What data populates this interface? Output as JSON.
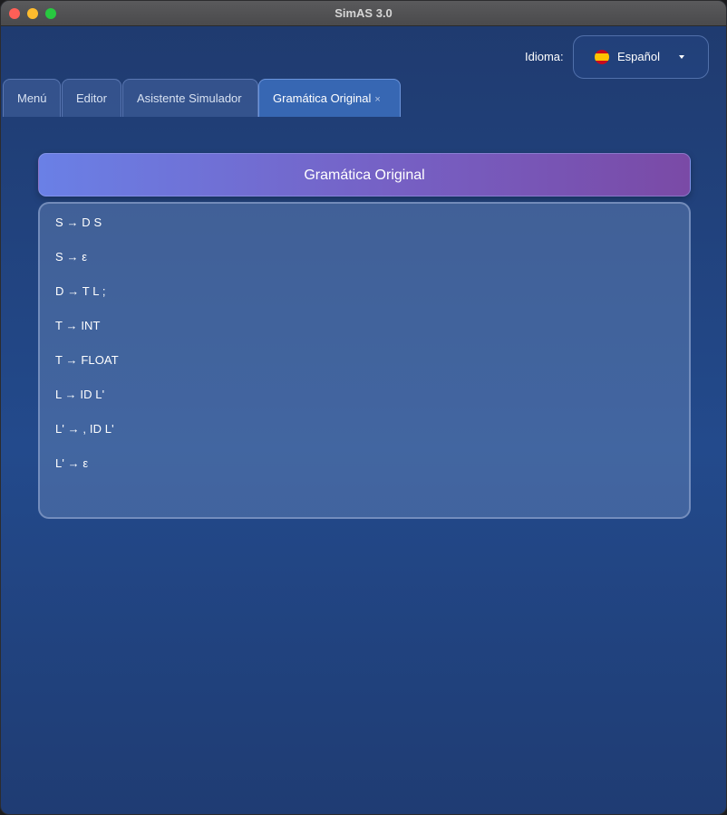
{
  "window": {
    "title": "SimAS 3.0"
  },
  "language": {
    "label": "Idioma:",
    "selected": "Español",
    "flag_icon": "spain-flag-icon"
  },
  "tabs": [
    {
      "label": "Menú"
    },
    {
      "label": "Editor"
    },
    {
      "label": "Asistente Simulador"
    },
    {
      "label": "Gramática Original",
      "close": "×",
      "active": true
    }
  ],
  "panel": {
    "title": "Gramática Original"
  },
  "rules": [
    "S → D S",
    "S → ε",
    "D → T L ;",
    "T → INT",
    "T → FLOAT",
    "L → ID L'",
    "L' → , ID L'",
    "L' → ε"
  ],
  "colors": {
    "background": "#234a8c",
    "header_start": "#6a80e6",
    "header_end": "#7a4aa6",
    "active_tab": "#3c6ebe"
  }
}
